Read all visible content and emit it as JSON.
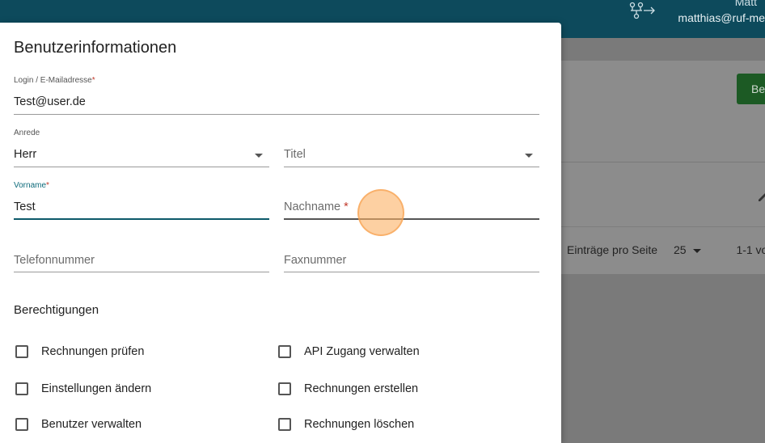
{
  "header": {
    "user_name": "Matt",
    "user_email": "matthias@ruf-me"
  },
  "background": {
    "primary_button_label": "Be",
    "pager": {
      "label": "Einträge pro Seite",
      "page_size": "25",
      "range": "1-1 vo"
    }
  },
  "dialog": {
    "title": "Benutzerinformationen",
    "login": {
      "label": "Login / E-Mailadresse",
      "required_mark": "*",
      "value": "Test@user.de"
    },
    "salutation": {
      "label": "Anrede",
      "value": "Herr"
    },
    "title_field": {
      "placeholder": "Titel"
    },
    "first_name": {
      "label": "Vorname",
      "required_mark": "*",
      "value": "Test"
    },
    "last_name": {
      "placeholder": "Nachname",
      "required_mark": "*"
    },
    "phone": {
      "placeholder": "Telefonnummer"
    },
    "fax": {
      "placeholder": "Faxnummer"
    },
    "permissions": {
      "title": "Berechtigungen",
      "items": [
        {
          "label": "Rechnungen prüfen",
          "checked": false
        },
        {
          "label": "API Zugang verwalten",
          "checked": false
        },
        {
          "label": "Einstellungen ändern",
          "checked": false
        },
        {
          "label": "Rechnungen erstellen",
          "checked": false
        },
        {
          "label": "Benutzer verwalten",
          "checked": false
        },
        {
          "label": "Rechnungen löschen",
          "checked": false
        }
      ]
    }
  },
  "colors": {
    "topbar": "#0d4a5c",
    "accent": "#0d6a7a",
    "required": "#c0392b",
    "primary_button": "#1c5a24"
  }
}
